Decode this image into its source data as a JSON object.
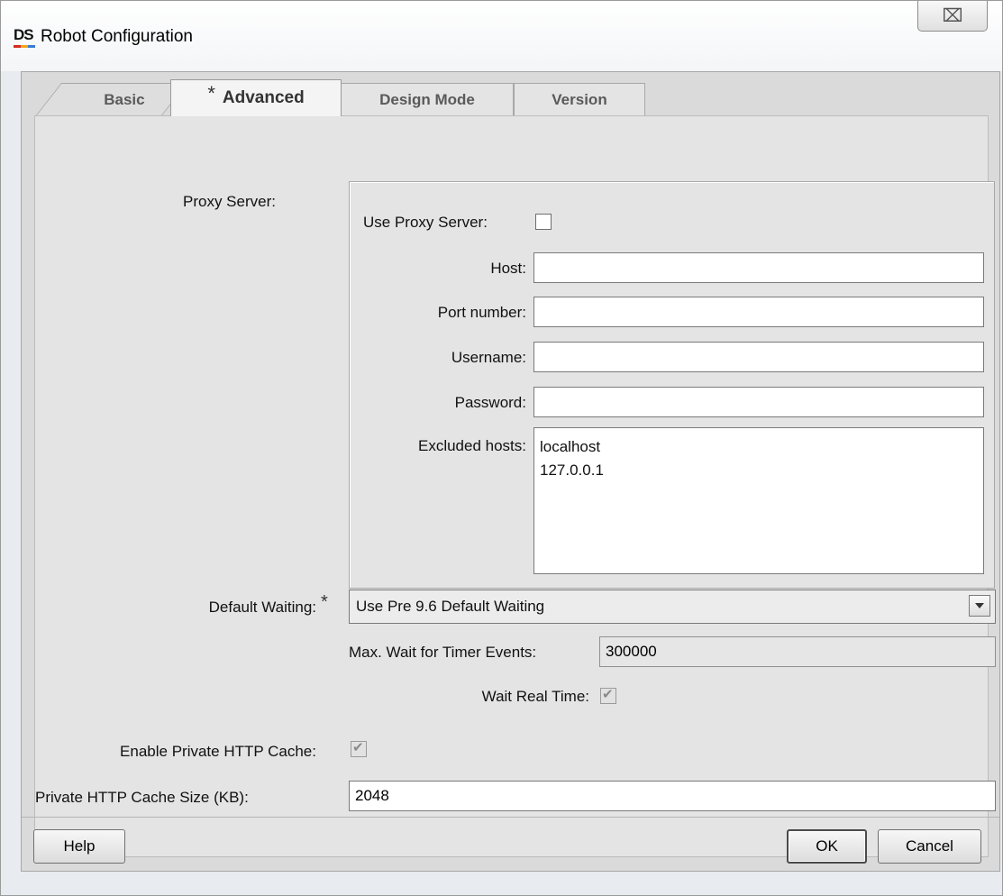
{
  "window": {
    "logo": "DS",
    "title": "Robot Configuration",
    "close_glyph": "⌧"
  },
  "tabs": [
    {
      "label": "Basic",
      "active": false
    },
    {
      "label": "Advanced",
      "active": true,
      "modified_marker": "*"
    },
    {
      "label": "Design Mode",
      "active": false
    },
    {
      "label": "Version",
      "active": false
    }
  ],
  "proxy": {
    "section_label": "Proxy Server:",
    "use_proxy_label": "Use Proxy Server:",
    "use_proxy_checked": false,
    "host_label": "Host:",
    "host_value": "",
    "port_label": "Port number:",
    "port_value": "",
    "username_label": "Username:",
    "username_value": "",
    "password_label": "Password:",
    "password_value": "",
    "excluded_label": "Excluded hosts:",
    "excluded_value": "localhost\n127.0.0.1"
  },
  "waiting": {
    "label": "Default Waiting:",
    "modified_marker": "*",
    "selected": "Use Pre 9.6 Default Waiting",
    "max_wait_label": "Max. Wait for Timer Events:",
    "max_wait_value": "300000",
    "real_time_label": "Wait Real Time:",
    "real_time_checked": true
  },
  "cache": {
    "enable_label": "Enable Private HTTP Cache:",
    "enable_checked": true,
    "size_label": "Private HTTP Cache Size (KB):",
    "size_value": "2048"
  },
  "buttons": {
    "help": "Help",
    "ok": "OK",
    "cancel": "Cancel"
  },
  "colors": {
    "logo_bars": [
      "#d62b1f",
      "#f2a51a",
      "#3a7bd5"
    ]
  }
}
